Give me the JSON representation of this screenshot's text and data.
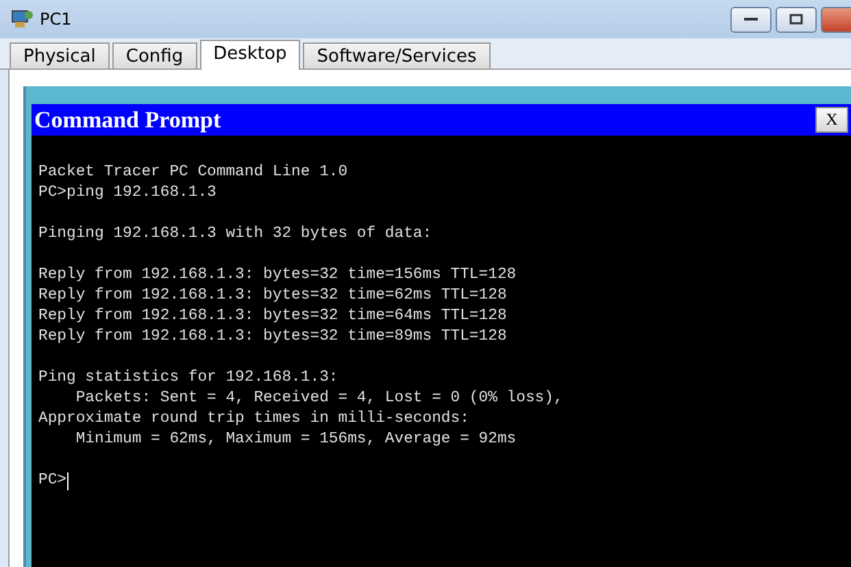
{
  "window": {
    "title": "PC1"
  },
  "tabs": [
    {
      "label": "Physical",
      "selected": false
    },
    {
      "label": "Config",
      "selected": false
    },
    {
      "label": "Desktop",
      "selected": true
    },
    {
      "label": "Software/Services",
      "selected": false
    }
  ],
  "command_prompt": {
    "title": "Command Prompt",
    "close": "X",
    "blocks": [
      [
        "Packet Tracer PC Command Line 1.0",
        "PC>ping 192.168.1.3"
      ],
      [
        "Pinging 192.168.1.3 with 32 bytes of data:"
      ],
      [
        "Reply from 192.168.1.3: bytes=32 time=156ms TTL=128",
        "Reply from 192.168.1.3: bytes=32 time=62ms TTL=128",
        "Reply from 192.168.1.3: bytes=32 time=64ms TTL=128",
        "Reply from 192.168.1.3: bytes=32 time=89ms TTL=128"
      ],
      [
        "Ping statistics for 192.168.1.3:",
        "    Packets: Sent = 4, Received = 4, Lost = 0 (0% loss),",
        "Approximate round trip times in milli-seconds:",
        "    Minimum = 62ms, Maximum = 156ms, Average = 92ms"
      ]
    ],
    "prompt": "PC>"
  }
}
